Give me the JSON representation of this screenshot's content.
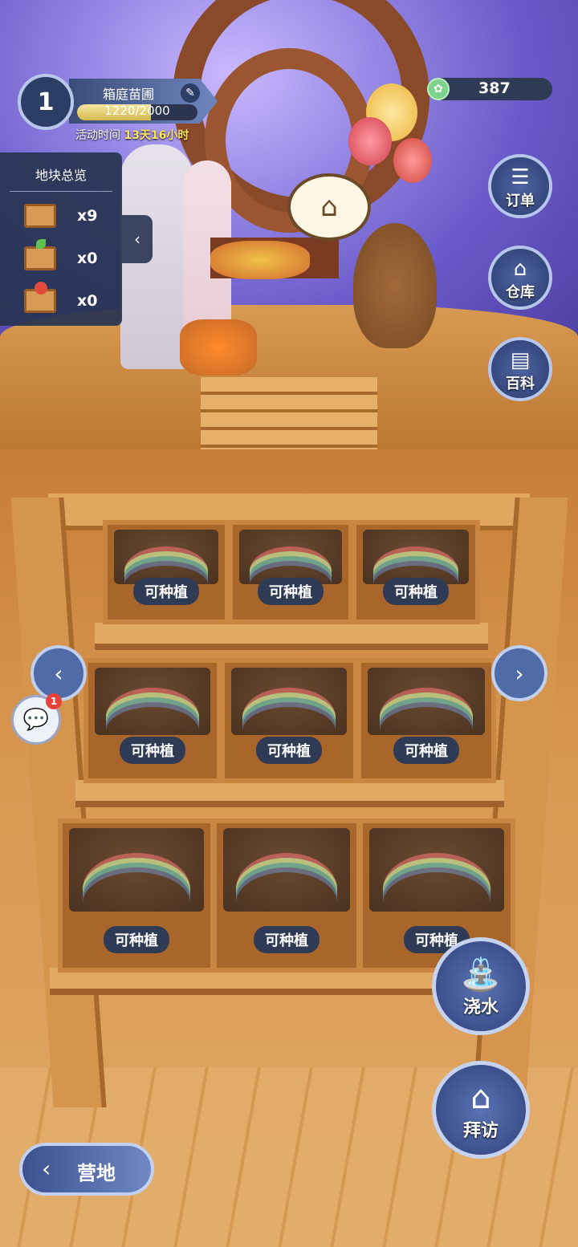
{
  "player": {
    "level": "1",
    "garden_name": "箱庭苗圃",
    "exp_text": "1220/2000",
    "exp_fraction": 0.61
  },
  "activity": {
    "label": "活动时间",
    "time": "13天16小时"
  },
  "currency": {
    "value": "387"
  },
  "overview": {
    "title": "地块总览",
    "rows": [
      {
        "icon": "empty-crate-icon",
        "count": "x9"
      },
      {
        "icon": "sprout-crate-icon",
        "count": "x0"
      },
      {
        "icon": "fruit-crate-icon",
        "count": "x0"
      }
    ]
  },
  "side_menu": {
    "orders": "订单",
    "warehouse": "仓库",
    "encyclopedia": "百科"
  },
  "plots": [
    {
      "label": "可种植"
    },
    {
      "label": "可种植"
    },
    {
      "label": "可种植"
    },
    {
      "label": "可种植"
    },
    {
      "label": "可种植"
    },
    {
      "label": "可种植"
    },
    {
      "label": "可种植"
    },
    {
      "label": "可种植"
    },
    {
      "label": "可种植"
    }
  ],
  "chat": {
    "badge": "1"
  },
  "actions": {
    "water": "浇水",
    "visit": "拜访"
  },
  "back": {
    "label": "营地"
  },
  "colors": {
    "panel": "#2f3a55",
    "accent": "#ffe35a",
    "wood": "#c98643"
  }
}
